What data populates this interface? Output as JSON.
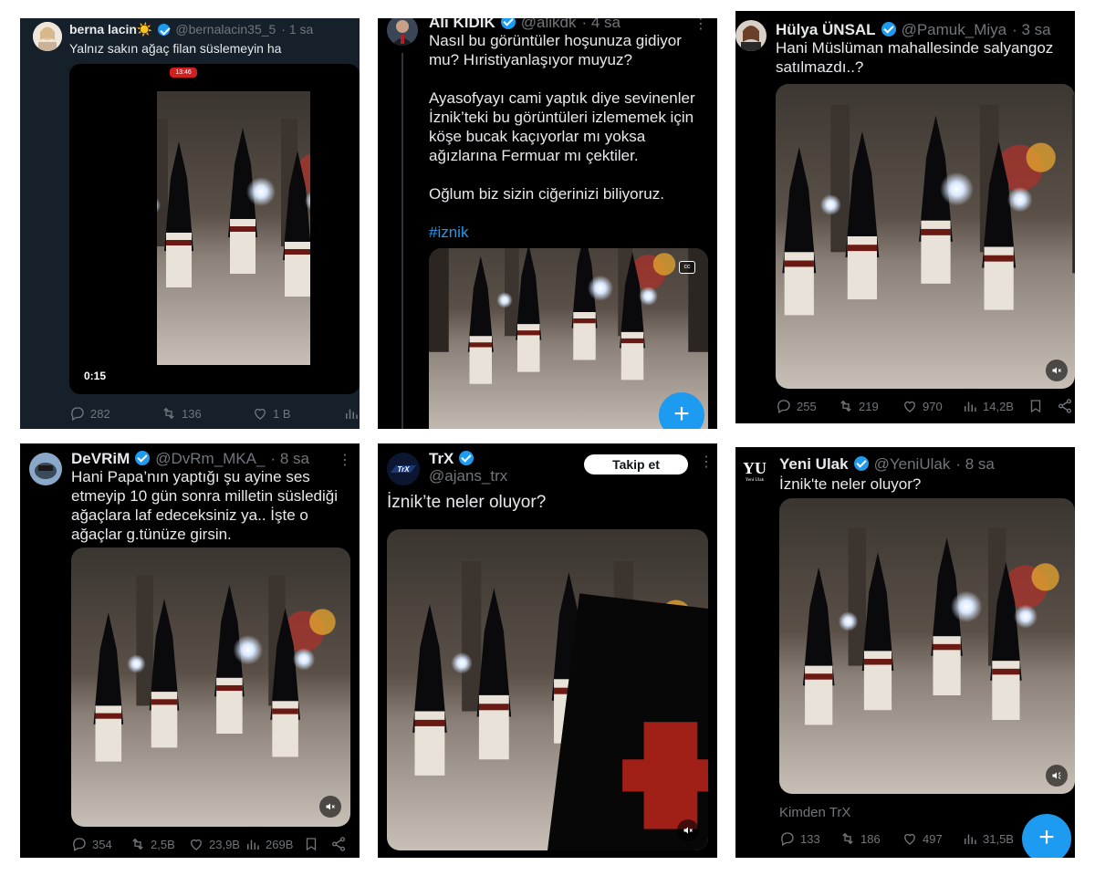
{
  "colors": {
    "accent": "#1d9bf0",
    "muted": "#71767b",
    "text": "#e7e9ea",
    "background": "#000000"
  },
  "posts": [
    {
      "name": "berna lacin☀️",
      "handle": "@bernalacin35_5",
      "time": "· 1 sa",
      "text": "Yalnız sakın ağaç filan süslemeyin ha",
      "phone_clock": "13:46",
      "video_time": "0:15",
      "replies": "282",
      "reposts": "136",
      "likes": "1 B"
    },
    {
      "name": "Ali KIDIK",
      "handle": "@alikdk",
      "time": "· 4 sa",
      "paragraphs": [
        "Nasıl bu görüntüler hoşunuza gidiyor mu? Hıristiyanlaşıyor muyuz?",
        "Ayasofyayı cami yaptık diye sevinenler İznik’teki bu görüntüleri izlememek için köşe bucak kaçıyorlar mı yoksa ağızlarına Fermuar mı çektiler.",
        "Oğlum biz sizin ciğerinizi biliyoruz."
      ],
      "hashtag": "#iznik",
      "fab": "+"
    },
    {
      "name": "Hülya ÜNSAL",
      "handle": "@Pamuk_Miya",
      "time": "· 3 sa",
      "text": "Hani Müslüman mahallesinde salyangoz satılmazdı..?",
      "replies": "255",
      "reposts": "219",
      "likes": "970",
      "views": "14,2B"
    },
    {
      "name": "DeVRiM",
      "handle": "@DvRm_MKA_",
      "time": "· 8 sa",
      "text": "Hani Papa’nın yaptığı şu ayine ses etmeyip 10 gün sonra milletin süslediği ağaçlara laf edeceksiniz ya.. İşte o ağaçlar g.tünüze girsin.",
      "replies": "354",
      "reposts": "2,5B",
      "likes": "23,9B",
      "views": "269B"
    },
    {
      "name": "TrX",
      "handle": "@ajans_trx",
      "follow_label": "Takip et",
      "text": "İznik’te neler oluyor?",
      "logo_text": "TrX"
    },
    {
      "name": "Yeni Ulak",
      "handle": "@YeniUlak",
      "time": "· 8 sa",
      "text": "İznik'te neler oluyor?",
      "logo_text": "YU",
      "logo_sub": "Yeni Ulak",
      "source": "Kimden TrX",
      "replies": "133",
      "reposts": "186",
      "likes": "497",
      "views": "31,5B",
      "fab": "+"
    }
  ]
}
